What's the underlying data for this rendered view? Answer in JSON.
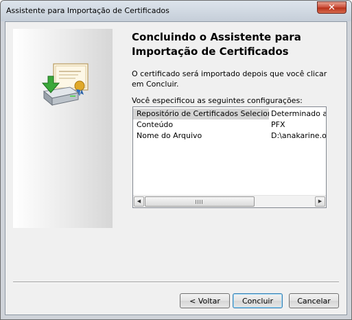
{
  "window": {
    "title": "Assistente para Importação de Certificados",
    "close_icon": "close-icon (×)"
  },
  "wizard": {
    "heading": "Concluindo o Assistente para Importação de Certificados",
    "description": "O certificado será importado depois que você clicar em Concluir.",
    "config_label": "Você especificou as seguintes configurações:",
    "settings": [
      {
        "key": "Repositório de Certificados Selecionado",
        "value": "Determinado automaticamente pelo assistente",
        "selected": true
      },
      {
        "key": "Conteúdo",
        "value": "PFX",
        "selected": false
      },
      {
        "key": "Nome do Arquivo",
        "value": "D:\\anakarine.oliveira",
        "selected": false
      }
    ],
    "image_icon": "certificate-import-icon"
  },
  "buttons": {
    "back": "< Voltar",
    "finish": "Concluir",
    "cancel": "Cancelar"
  },
  "colors": {
    "selection": "#d4d4d4",
    "default_button_border": "#3c7fb1",
    "close_button": "#c84a36"
  }
}
